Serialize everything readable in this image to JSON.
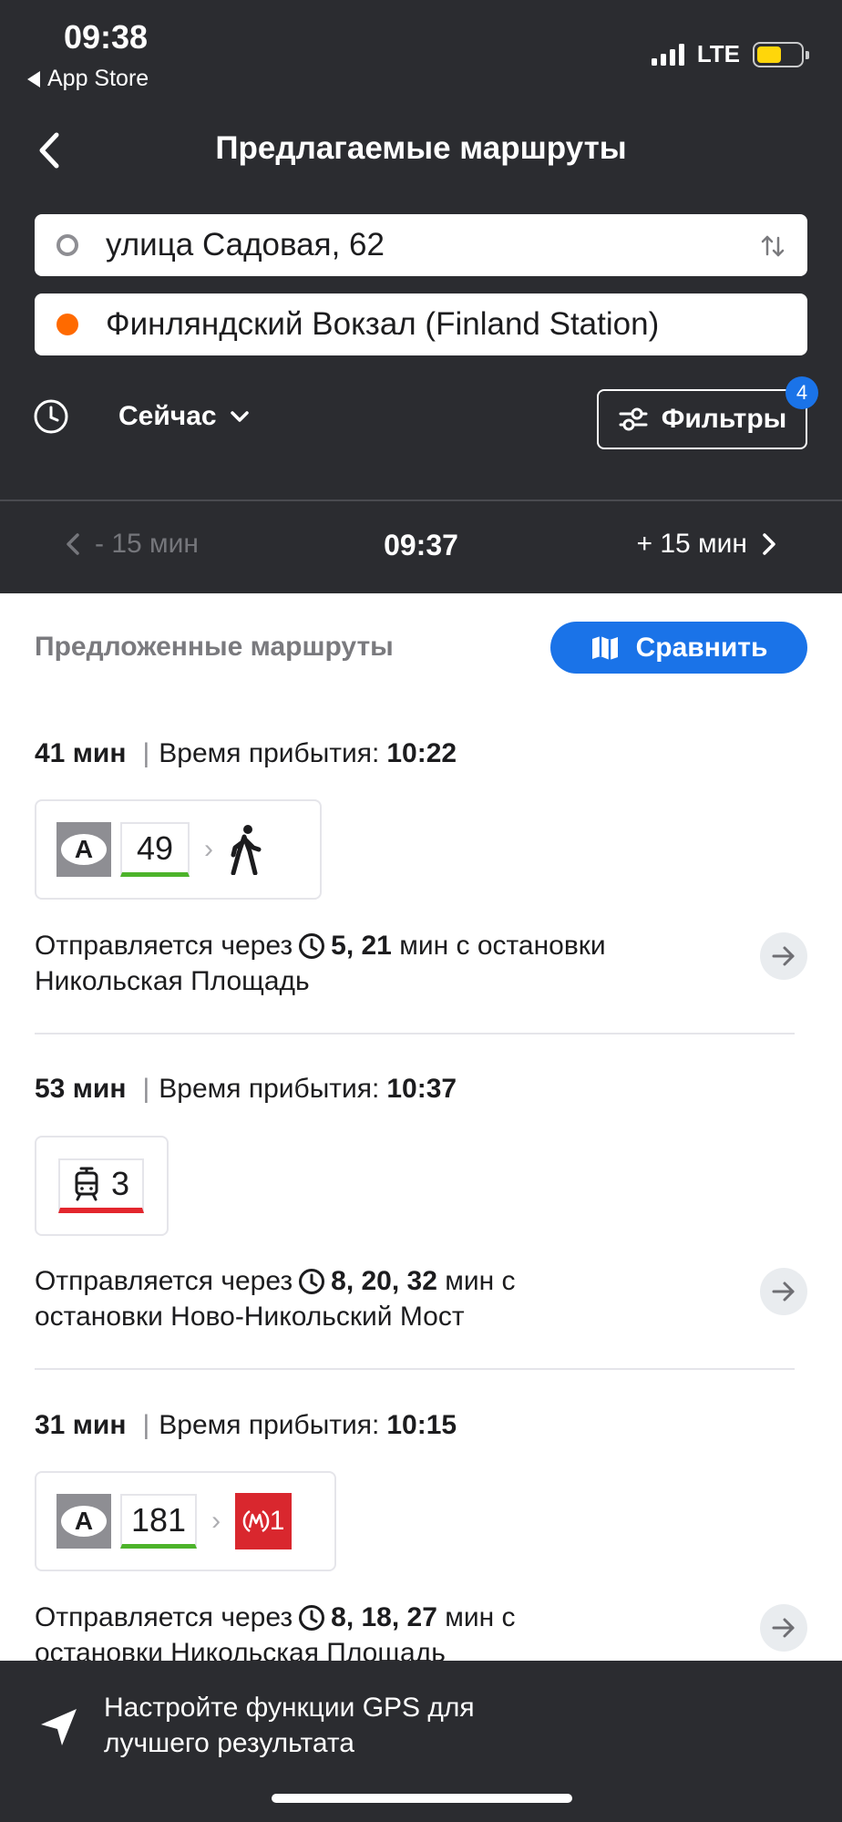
{
  "status_bar": {
    "time": "09:38",
    "back_app": "App Store",
    "network": "LTE",
    "battery_color": "#ffd60a"
  },
  "nav": {
    "title": "Предлагаемые маршруты"
  },
  "search": {
    "from": "улица Садовая, 62",
    "to": "Финляндский Вокзал (Finland Station)",
    "from_dot_color": "#8e8e93",
    "to_dot_color": "#ff6a00"
  },
  "time_selector": {
    "label": "Сейчас"
  },
  "filters": {
    "label": "Фильтры",
    "badge": "4"
  },
  "time_shift": {
    "prev": "- 15 мин",
    "current": "09:37",
    "next": "+ 15 мин"
  },
  "routes_section": {
    "title": "Предложенные маршруты",
    "compare_label": "Сравнить"
  },
  "routes": [
    {
      "duration": "41 мин",
      "arrival_label": "Время прибытия:",
      "arrival_time": "10:22",
      "bus_letter": "A",
      "line": "49",
      "depart_prefix": "Отправляется  через",
      "depart_times": "5, 21",
      "depart_suffix": "мин  с остановки",
      "stop": "Никольская Площадь"
    },
    {
      "duration": "53 мин",
      "arrival_label": "Время прибытия:",
      "arrival_time": "10:37",
      "line": "3",
      "depart_prefix": "Отправляется  через",
      "depart_times": "8, 20, 32",
      "depart_suffix": "мин  с",
      "stop": "остановки Ново-Никольский Мост"
    },
    {
      "duration": "31 мин",
      "arrival_label": "Время прибытия:",
      "arrival_time": "10:15",
      "bus_letter": "A",
      "line": "181",
      "metro_line": "1",
      "depart_prefix": "Отправляется  через",
      "depart_times": "8, 18, 27",
      "depart_suffix": "мин  с",
      "stop": "остановки Никольская Площадь"
    }
  ],
  "gps_banner": {
    "line1": "Настройте функции GPS для",
    "line2": "лучшего результата"
  },
  "colors": {
    "header_bg": "#2b2c30",
    "accent_blue": "#1a73e8",
    "bus_line_green": "#4cb32a",
    "tram_red": "#e3262d",
    "metro_red": "#d9272e"
  }
}
